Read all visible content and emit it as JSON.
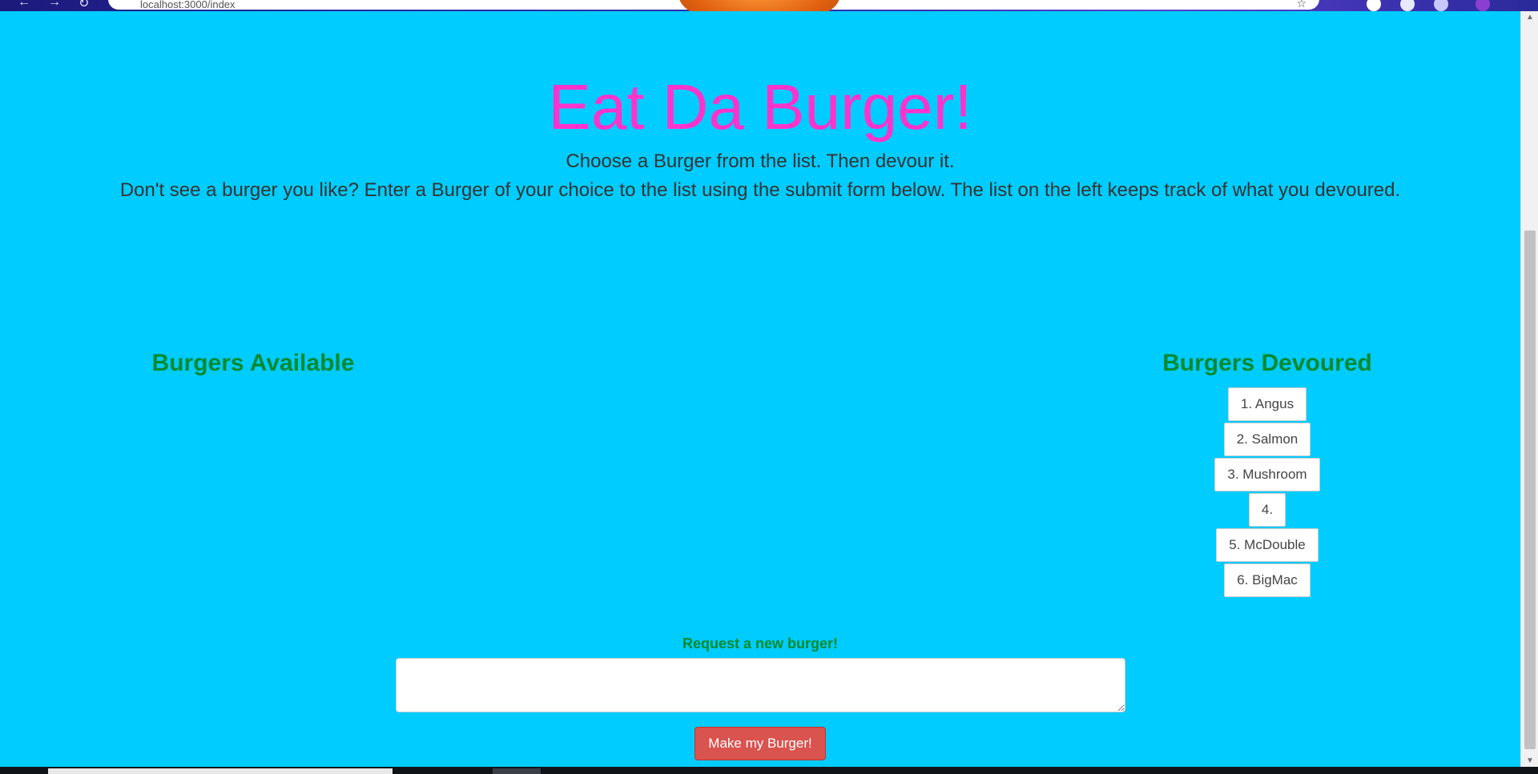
{
  "browser": {
    "url_text": "localhost:3000/index",
    "icons": [
      "back-arrow-icon",
      "forward-arrow-icon",
      "reload-icon",
      "star-icon"
    ]
  },
  "header": {
    "title": "Eat Da Burger!",
    "line1": "Choose a Burger from the list. Then devour it.",
    "line2": "Don't see a burger you like? Enter a Burger of your choice to the list using the submit form below. The list on the left keeps track of what you devoured."
  },
  "available": {
    "heading": "Burgers Available",
    "items": []
  },
  "devoured": {
    "heading": "Burgers Devoured",
    "items": [
      {
        "label": "1. Angus"
      },
      {
        "label": "2. Salmon"
      },
      {
        "label": "3. Mushroom"
      },
      {
        "label": "4."
      },
      {
        "label": "5. McDouble"
      },
      {
        "label": "6. BigMac"
      }
    ]
  },
  "form": {
    "label": "Request a new burger!",
    "input_value": "",
    "submit_label": "Make my Burger!"
  },
  "colors": {
    "background": "#00ccff",
    "title": "#ff33cc",
    "headings": "#008a2e",
    "button": "#d9534f"
  }
}
